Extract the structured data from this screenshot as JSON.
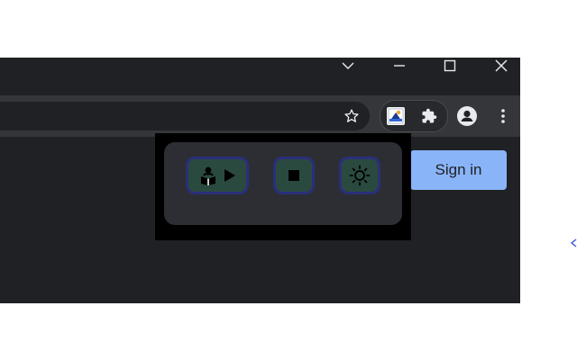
{
  "window": {
    "controls": [
      {
        "name": "tab-search",
        "icon": "chevron-down-icon"
      },
      {
        "name": "minimize",
        "icon": "minimize-icon"
      },
      {
        "name": "maximize",
        "icon": "maximize-icon"
      },
      {
        "name": "close",
        "icon": "close-icon"
      }
    ]
  },
  "toolbar": {
    "icons": [
      "star-icon",
      "extension-app-icon",
      "puzzle-icon",
      "profile-icon",
      "menu-icon"
    ]
  },
  "page": {
    "signin_label": "Sign in"
  },
  "extension_popup": {
    "buttons": [
      {
        "name": "reader-play-button",
        "icons": [
          "reader-person-icon",
          "play-icon"
        ]
      },
      {
        "name": "stop-button",
        "icons": [
          "stop-icon"
        ]
      },
      {
        "name": "brightness-button",
        "icons": [
          "sun-icon"
        ]
      }
    ]
  },
  "colors": {
    "chrome_dark": "#202124",
    "toolbar": "#35363a",
    "signin_bg": "#8ab4f8",
    "popup_bg": "#000000",
    "popup_panel": "#2d2e33",
    "button_fill": "#2a4a3f",
    "button_border": "#2a2f7a"
  }
}
